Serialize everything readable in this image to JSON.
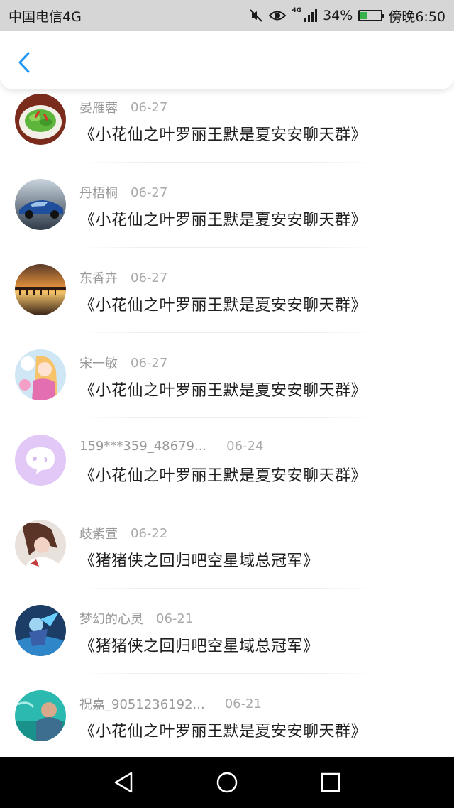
{
  "status_bar": {
    "carrier": "中国电信4G",
    "net_type": "4G",
    "battery_text": "34%",
    "battery_level": 0.34,
    "time_text": "傍晚6:50",
    "icons": [
      "mute-icon",
      "eye-icon",
      "signal-icon",
      "battery-icon"
    ]
  },
  "header": {
    "back_icon": "chevron-left-icon",
    "accent_color": "#2196f3"
  },
  "messages": [
    {
      "name": "晏雁蓉",
      "date": "06-27",
      "text": "《小花仙之叶罗丽王默是夏安安聊天群》",
      "avatar": "vegetable-dish-photo"
    },
    {
      "name": "丹梧桐",
      "date": "06-27",
      "text": "《小花仙之叶罗丽王默是夏安安聊天群》",
      "avatar": "blue-car-photo"
    },
    {
      "name": "东香卉",
      "date": "06-27",
      "text": "《小花仙之叶罗丽王默是夏安安聊天群》",
      "avatar": "sunset-pier-photo"
    },
    {
      "name": "宋一敏",
      "date": "06-27",
      "text": "《小花仙之叶罗丽王默是夏安安聊天群》",
      "avatar": "anime-girl-photo"
    },
    {
      "name": "159***359_48679...",
      "date": "06-24",
      "text": "《小花仙之叶罗丽王默是夏安安聊天群》",
      "avatar": "default-chat-avatar"
    },
    {
      "name": "歧紫萱",
      "date": "06-22",
      "text": "《猪猪侠之回归吧空星域总冠军》",
      "avatar": "portrait-photo"
    },
    {
      "name": "梦幻的心灵",
      "date": "06-21",
      "text": "《猪猪侠之回归吧空星域总冠军》",
      "avatar": "game-character-photo"
    },
    {
      "name": "祝嘉_9051236192...",
      "date": "06-21",
      "text": "《小花仙之叶罗丽王默是夏安安聊天群》",
      "avatar": "pool-photo"
    }
  ],
  "nav_bar": {
    "icons": [
      "back-triangle-icon",
      "home-circle-icon",
      "recents-square-icon"
    ]
  }
}
